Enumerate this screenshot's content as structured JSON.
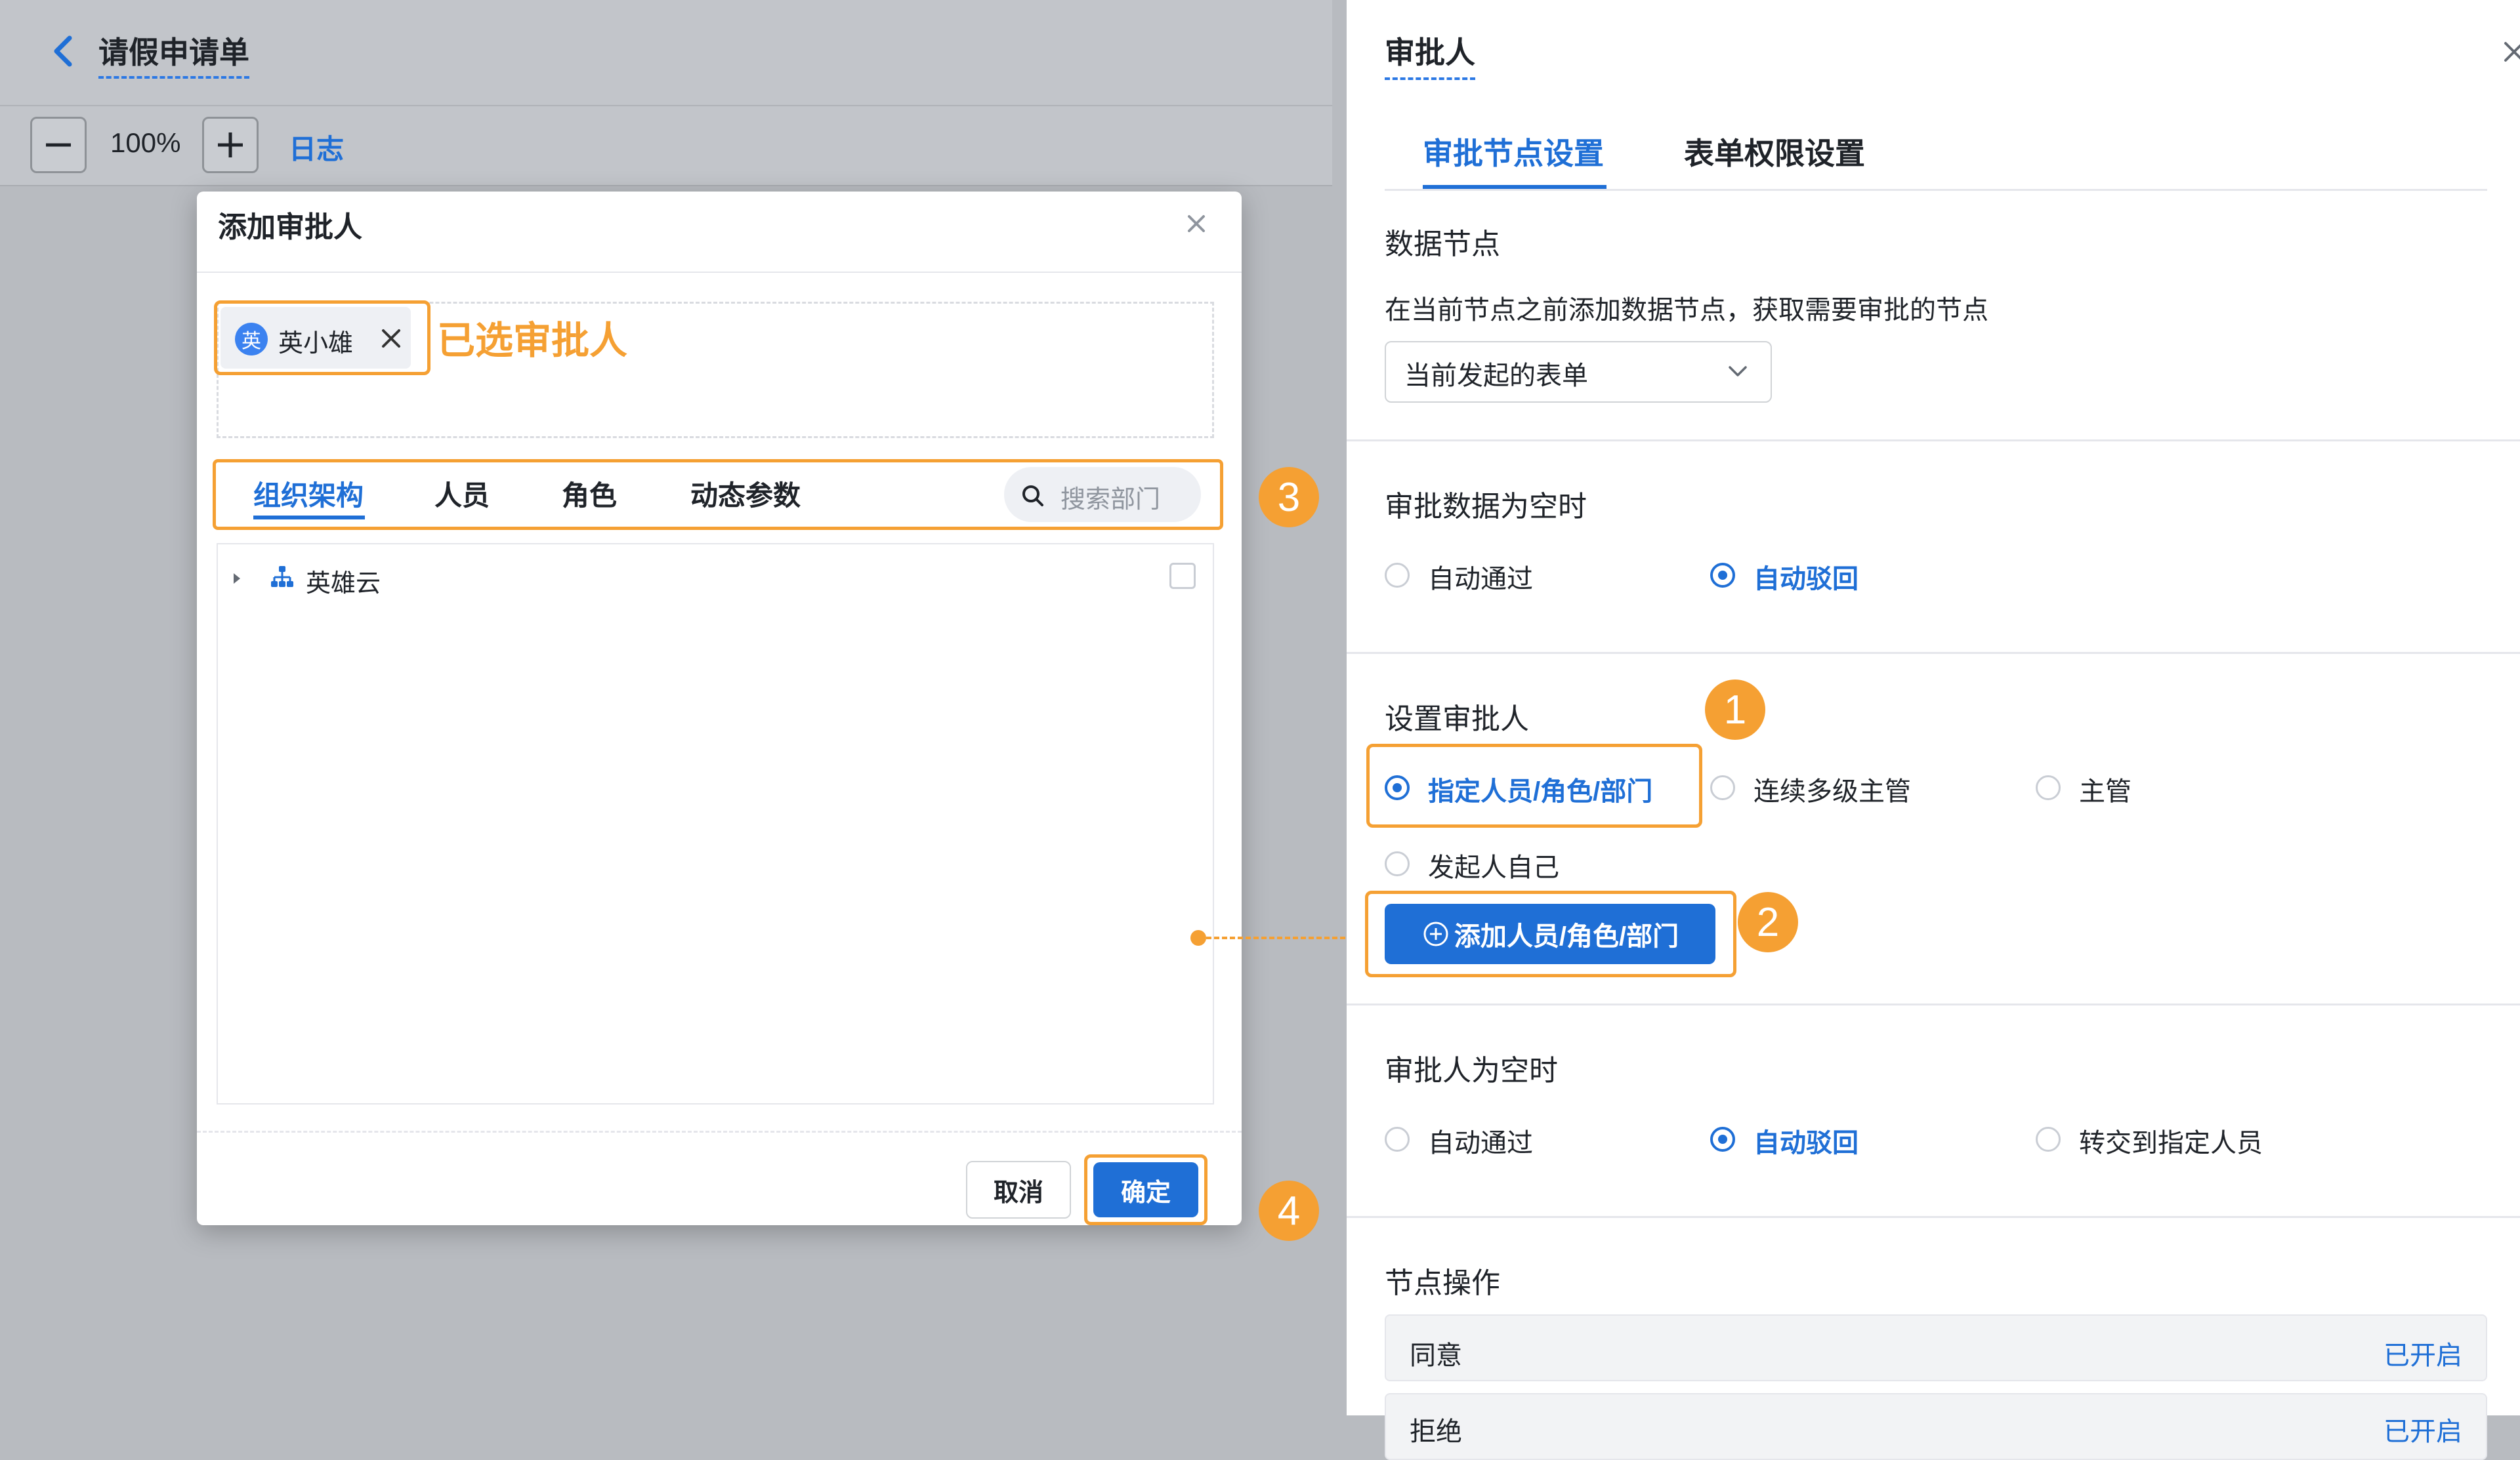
{
  "header": {
    "title": "请假申请单"
  },
  "toolbar": {
    "zoom": "100%",
    "log_label": "日志"
  },
  "modal": {
    "title": "添加审批人",
    "selected": [
      {
        "avatar": "英",
        "name": "英小雄"
      }
    ],
    "selected_note": "已选审批人",
    "tabs": [
      "组织架构",
      "人员",
      "角色",
      "动态参数"
    ],
    "search_placeholder": "搜索部门",
    "tree": [
      {
        "label": "英雄云"
      }
    ],
    "cancel_label": "取消",
    "ok_label": "确定"
  },
  "badges": {
    "one": "1",
    "two": "2",
    "three": "3",
    "four": "4"
  },
  "panel": {
    "title": "审批人",
    "tabs": [
      "审批节点设置",
      "表单权限设置"
    ],
    "data_node": {
      "title": "数据节点",
      "desc": "在当前节点之前添加数据节点，获取需要审批的节点",
      "select_value": "当前发起的表单"
    },
    "empty_data": {
      "title": "审批数据为空时",
      "options": [
        "自动通过",
        "自动驳回"
      ],
      "selected": "自动驳回"
    },
    "approver": {
      "title": "设置审批人",
      "options": [
        "指定人员/角色/部门",
        "连续多级主管",
        "主管",
        "发起人自己"
      ],
      "selected": "指定人员/角色/部门",
      "add_button": "添加人员/角色/部门"
    },
    "empty_approver": {
      "title": "审批人为空时",
      "options": [
        "自动通过",
        "自动驳回",
        "转交到指定人员"
      ],
      "selected": "自动驳回"
    },
    "node_ops": {
      "title": "节点操作",
      "rows": [
        {
          "label": "同意",
          "status": "已开启"
        },
        {
          "label": "拒绝",
          "status": "已开启"
        }
      ]
    }
  },
  "colors": {
    "accent": "#1f6fd6",
    "annotation": "#f5a033"
  }
}
